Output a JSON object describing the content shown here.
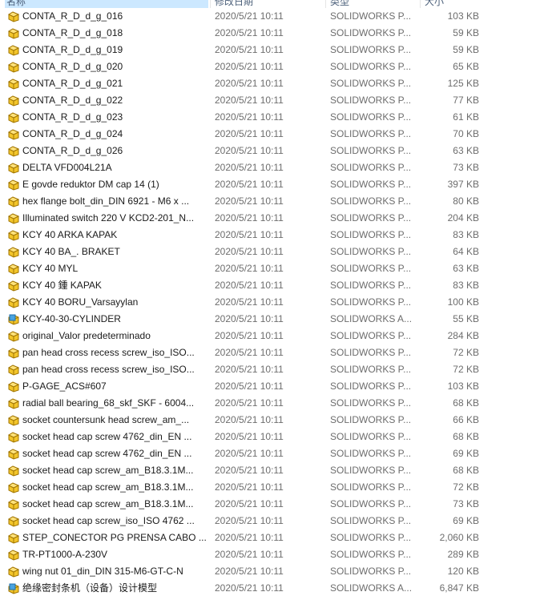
{
  "columns": {
    "name": "名称",
    "date": "修改日期",
    "type": "类型",
    "size": "大小"
  },
  "files": [
    {
      "name": "CONTA_R_D_d_g_016",
      "date": "2020/5/21 10:11",
      "type": "SOLIDWORKS P...",
      "size": "103 KB",
      "icon": "solidworks-part-icon"
    },
    {
      "name": "CONTA_R_D_d_g_018",
      "date": "2020/5/21 10:11",
      "type": "SOLIDWORKS P...",
      "size": "59 KB",
      "icon": "solidworks-part-icon"
    },
    {
      "name": "CONTA_R_D_d_g_019",
      "date": "2020/5/21 10:11",
      "type": "SOLIDWORKS P...",
      "size": "59 KB",
      "icon": "solidworks-part-icon"
    },
    {
      "name": "CONTA_R_D_d_g_020",
      "date": "2020/5/21 10:11",
      "type": "SOLIDWORKS P...",
      "size": "65 KB",
      "icon": "solidworks-part-icon"
    },
    {
      "name": "CONTA_R_D_d_g_021",
      "date": "2020/5/21 10:11",
      "type": "SOLIDWORKS P...",
      "size": "125 KB",
      "icon": "solidworks-part-icon"
    },
    {
      "name": "CONTA_R_D_d_g_022",
      "date": "2020/5/21 10:11",
      "type": "SOLIDWORKS P...",
      "size": "77 KB",
      "icon": "solidworks-part-icon"
    },
    {
      "name": "CONTA_R_D_d_g_023",
      "date": "2020/5/21 10:11",
      "type": "SOLIDWORKS P...",
      "size": "61 KB",
      "icon": "solidworks-part-icon"
    },
    {
      "name": "CONTA_R_D_d_g_024",
      "date": "2020/5/21 10:11",
      "type": "SOLIDWORKS P...",
      "size": "70 KB",
      "icon": "solidworks-part-icon"
    },
    {
      "name": "CONTA_R_D_d_g_026",
      "date": "2020/5/21 10:11",
      "type": "SOLIDWORKS P...",
      "size": "63 KB",
      "icon": "solidworks-part-icon"
    },
    {
      "name": "DELTA VFD004L21A",
      "date": "2020/5/21 10:11",
      "type": "SOLIDWORKS P...",
      "size": "73 KB",
      "icon": "solidworks-part-icon"
    },
    {
      "name": "E govde reduktor DM cap 14 (1)",
      "date": "2020/5/21 10:11",
      "type": "SOLIDWORKS P...",
      "size": "397 KB",
      "icon": "solidworks-part-icon"
    },
    {
      "name": "hex flange bolt_din_DIN 6921 - M6 x ...",
      "date": "2020/5/21 10:11",
      "type": "SOLIDWORKS P...",
      "size": "80 KB",
      "icon": "solidworks-part-icon"
    },
    {
      "name": "Illuminated switch 220 V KCD2-201_N...",
      "date": "2020/5/21 10:11",
      "type": "SOLIDWORKS P...",
      "size": "204 KB",
      "icon": "solidworks-part-icon"
    },
    {
      "name": "KCY  40  ARKA KAPAK",
      "date": "2020/5/21 10:11",
      "type": "SOLIDWORKS P...",
      "size": "83 KB",
      "icon": "solidworks-part-icon"
    },
    {
      "name": "KCY  40  BA_. BRAKET",
      "date": "2020/5/21 10:11",
      "type": "SOLIDWORKS P...",
      "size": "64 KB",
      "icon": "solidworks-part-icon"
    },
    {
      "name": "KCY  40  MYL",
      "date": "2020/5/21 10:11",
      "type": "SOLIDWORKS P...",
      "size": "63 KB",
      "icon": "solidworks-part-icon"
    },
    {
      "name": "KCY  40  鍾 KAPAK",
      "date": "2020/5/21 10:11",
      "type": "SOLIDWORKS P...",
      "size": "83 KB",
      "icon": "solidworks-part-icon"
    },
    {
      "name": "KCY 40  BORU_Varsayylan",
      "date": "2020/5/21 10:11",
      "type": "SOLIDWORKS P...",
      "size": "100 KB",
      "icon": "solidworks-part-icon"
    },
    {
      "name": "KCY-40-30-CYLINDER",
      "date": "2020/5/21 10:11",
      "type": "SOLIDWORKS A...",
      "size": "55 KB",
      "icon": "solidworks-assembly-icon"
    },
    {
      "name": "original_Valor predeterminado",
      "date": "2020/5/21 10:11",
      "type": "SOLIDWORKS P...",
      "size": "284 KB",
      "icon": "solidworks-part-icon"
    },
    {
      "name": "pan head cross recess screw_iso_ISO...",
      "date": "2020/5/21 10:11",
      "type": "SOLIDWORKS P...",
      "size": "72 KB",
      "icon": "solidworks-part-icon"
    },
    {
      "name": "pan head cross recess screw_iso_ISO...",
      "date": "2020/5/21 10:11",
      "type": "SOLIDWORKS P...",
      "size": "72 KB",
      "icon": "solidworks-part-icon"
    },
    {
      "name": "P-GAGE_ACS#607",
      "date": "2020/5/21 10:11",
      "type": "SOLIDWORKS P...",
      "size": "103 KB",
      "icon": "solidworks-part-icon"
    },
    {
      "name": "radial ball bearing_68_skf_SKF - 6004...",
      "date": "2020/5/21 10:11",
      "type": "SOLIDWORKS P...",
      "size": "68 KB",
      "icon": "solidworks-part-icon"
    },
    {
      "name": "socket countersunk head screw_am_...",
      "date": "2020/5/21 10:11",
      "type": "SOLIDWORKS P...",
      "size": "66 KB",
      "icon": "solidworks-part-icon"
    },
    {
      "name": "socket head cap screw 4762_din_EN ...",
      "date": "2020/5/21 10:11",
      "type": "SOLIDWORKS P...",
      "size": "68 KB",
      "icon": "solidworks-part-icon"
    },
    {
      "name": "socket head cap screw 4762_din_EN ...",
      "date": "2020/5/21 10:11",
      "type": "SOLIDWORKS P...",
      "size": "69 KB",
      "icon": "solidworks-part-icon"
    },
    {
      "name": "socket head cap screw_am_B18.3.1M...",
      "date": "2020/5/21 10:11",
      "type": "SOLIDWORKS P...",
      "size": "68 KB",
      "icon": "solidworks-part-icon"
    },
    {
      "name": "socket head cap screw_am_B18.3.1M...",
      "date": "2020/5/21 10:11",
      "type": "SOLIDWORKS P...",
      "size": "72 KB",
      "icon": "solidworks-part-icon"
    },
    {
      "name": "socket head cap screw_am_B18.3.1M...",
      "date": "2020/5/21 10:11",
      "type": "SOLIDWORKS P...",
      "size": "73 KB",
      "icon": "solidworks-part-icon"
    },
    {
      "name": "socket head cap screw_iso_ISO 4762 ...",
      "date": "2020/5/21 10:11",
      "type": "SOLIDWORKS P...",
      "size": "69 KB",
      "icon": "solidworks-part-icon"
    },
    {
      "name": "STEP_CONECTOR PG PRENSA CABO ...",
      "date": "2020/5/21 10:11",
      "type": "SOLIDWORKS P...",
      "size": "2,060 KB",
      "icon": "solidworks-part-icon"
    },
    {
      "name": "TR-PT1000-A-230V",
      "date": "2020/5/21 10:11",
      "type": "SOLIDWORKS P...",
      "size": "289 KB",
      "icon": "solidworks-part-icon"
    },
    {
      "name": "wing nut 01_din_DIN 315-M6-GT-C-N",
      "date": "2020/5/21 10:11",
      "type": "SOLIDWORKS P...",
      "size": "120 KB",
      "icon": "solidworks-part-icon"
    },
    {
      "name": "绝缘密封条机（设备）设计模型",
      "date": "2020/5/21 10:11",
      "type": "SOLIDWORKS A...",
      "size": "6,847 KB",
      "icon": "solidworks-assembly-icon"
    }
  ],
  "colors": {
    "part_icon_fill": "#f2c52b",
    "part_icon_stroke": "#a07400",
    "assembly_icon_fill": "#4aa3df",
    "header_selected_bg": "#cce8ff"
  }
}
